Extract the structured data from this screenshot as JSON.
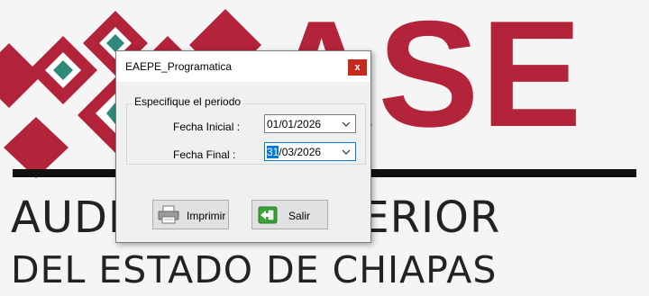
{
  "background": {
    "brand_letters": "ASE",
    "line1": "AUDITORÍA SUPERIOR",
    "line2": "DEL ESTADO DE CHIAPAS",
    "colors": {
      "brand_red": "#b3233a",
      "brand_teal": "#2e8b7a"
    }
  },
  "dialog": {
    "title": "EAEPE_Programatica",
    "close_label": "x",
    "group_label": "Especifique el periodo",
    "fecha_inicial_label": "Fecha Inicial :",
    "fecha_inicial_value": "01/01/2026",
    "fecha_final_label": "Fecha Final :",
    "fecha_final_selected": "31",
    "fecha_final_rest": "/03/2026",
    "imprimir_label": "Imprimir",
    "salir_label": "Salir",
    "icons": {
      "print": "printer-icon",
      "exit": "exit-icon",
      "dropdown": "chevron-down-icon"
    }
  }
}
